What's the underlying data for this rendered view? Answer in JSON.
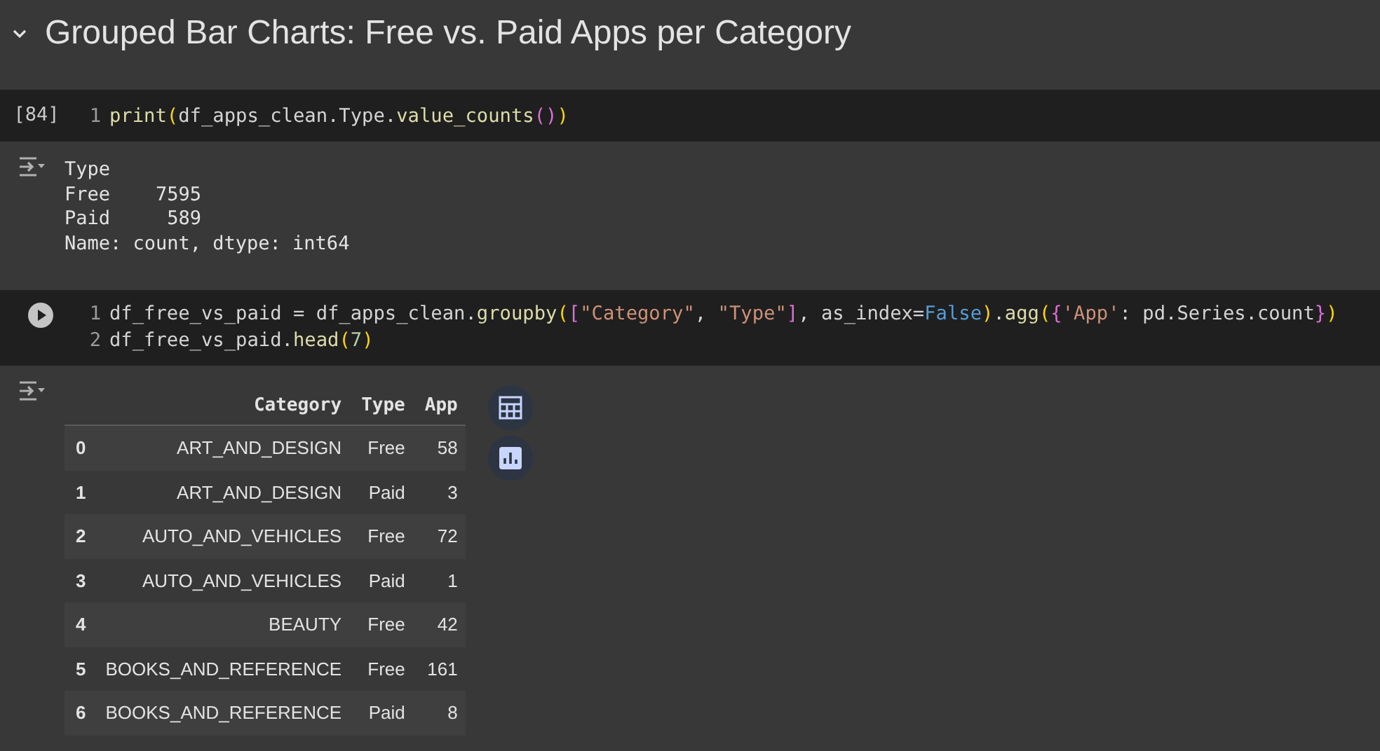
{
  "section": {
    "title": "Grouped Bar Charts: Free vs. Paid Apps per Category",
    "expanded": true
  },
  "cells": [
    {
      "execution_count": "[84]",
      "lines": [
        {
          "number": "1",
          "tokens": [
            {
              "kind": "func",
              "text": "print"
            },
            {
              "kind": "paren",
              "text": "("
            },
            {
              "kind": "plain",
              "text": "df_apps_clean.Type."
            },
            {
              "kind": "func",
              "text": "value_counts"
            },
            {
              "kind": "paren2",
              "text": "()"
            },
            {
              "kind": "paren",
              "text": ")"
            }
          ]
        }
      ],
      "output": {
        "kind": "text",
        "lines": [
          "Type",
          "Free    7595",
          "Paid     589",
          "Name: count, dtype: int64"
        ]
      }
    },
    {
      "lines": [
        {
          "number": "1",
          "tokens": [
            {
              "kind": "plain",
              "text": "df_free_vs_paid = df_apps_clean."
            },
            {
              "kind": "func",
              "text": "groupby"
            },
            {
              "kind": "paren",
              "text": "("
            },
            {
              "kind": "paren2",
              "text": "["
            },
            {
              "kind": "string",
              "text": "\"Category\""
            },
            {
              "kind": "plain",
              "text": ", "
            },
            {
              "kind": "string",
              "text": "\"Type\""
            },
            {
              "kind": "paren2",
              "text": "]"
            },
            {
              "kind": "plain",
              "text": ", as_index="
            },
            {
              "kind": "keyword",
              "text": "False"
            },
            {
              "kind": "paren",
              "text": ")"
            },
            {
              "kind": "plain",
              "text": "."
            },
            {
              "kind": "func",
              "text": "agg"
            },
            {
              "kind": "paren",
              "text": "("
            },
            {
              "kind": "paren2",
              "text": "{"
            },
            {
              "kind": "string",
              "text": "'App'"
            },
            {
              "kind": "plain",
              "text": ": pd.Series.count"
            },
            {
              "kind": "paren2",
              "text": "}"
            },
            {
              "kind": "paren",
              "text": ")"
            }
          ]
        },
        {
          "number": "2",
          "tokens": [
            {
              "kind": "plain",
              "text": "df_free_vs_paid."
            },
            {
              "kind": "func",
              "text": "head"
            },
            {
              "kind": "paren",
              "text": "("
            },
            {
              "kind": "number",
              "text": "7"
            },
            {
              "kind": "paren",
              "text": ")"
            }
          ]
        }
      ],
      "output": {
        "kind": "table",
        "columns": [
          "",
          "Category",
          "Type",
          "App"
        ],
        "rows": [
          [
            "0",
            "ART_AND_DESIGN",
            "Free",
            "58"
          ],
          [
            "1",
            "ART_AND_DESIGN",
            "Paid",
            "3"
          ],
          [
            "2",
            "AUTO_AND_VEHICLES",
            "Free",
            "72"
          ],
          [
            "3",
            "AUTO_AND_VEHICLES",
            "Paid",
            "1"
          ],
          [
            "4",
            "BEAUTY",
            "Free",
            "42"
          ],
          [
            "5",
            "BOOKS_AND_REFERENCE",
            "Free",
            "161"
          ],
          [
            "6",
            "BOOKS_AND_REFERENCE",
            "Paid",
            "8"
          ]
        ]
      }
    }
  ]
}
